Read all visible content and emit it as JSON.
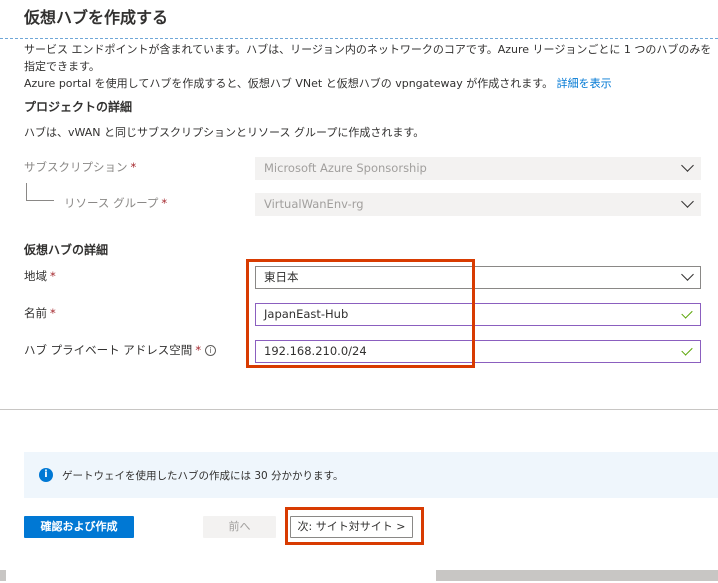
{
  "page": {
    "title": "仮想ハブを作成する"
  },
  "intro": {
    "line1": "サービス エンドポイントが含まれています。ハブは、リージョン内のネットワークのコアです。Azure リージョンごとに 1 つのハブのみを指定できます。",
    "line2": "Azure portal を使用してハブを作成すると、仮想ハブ VNet と仮想ハブの vpngateway が作成されます。",
    "link": "詳細を表示"
  },
  "project": {
    "heading": "プロジェクトの詳細",
    "description": "ハブは、vWAN と同じサブスクリプションとリソース グループに作成されます。",
    "subscription": {
      "label": "サブスクリプション",
      "value": "Microsoft Azure Sponsorship"
    },
    "resource_group": {
      "label": "リソース グループ",
      "value": "VirtualWanEnv-rg"
    }
  },
  "hub": {
    "heading": "仮想ハブの詳細",
    "region": {
      "label": "地域",
      "value": "東日本"
    },
    "name": {
      "label": "名前",
      "value": "JapanEast-Hub"
    },
    "address_space": {
      "label": "ハブ プライベート アドレス空間",
      "value": "192.168.210.0/24"
    }
  },
  "required_mark": "*",
  "info_glyph": "i",
  "notice": {
    "icon": "info-icon",
    "text": "ゲートウェイを使用したハブの作成には 30 分かかります。"
  },
  "buttons": {
    "review_create": "確認および作成",
    "previous": "前へ",
    "next": "次: サイト対サイト >"
  },
  "colors": {
    "accent": "#0078d4",
    "highlight": "#d83b01",
    "valid": "#57a300",
    "required": "#a4262c"
  }
}
